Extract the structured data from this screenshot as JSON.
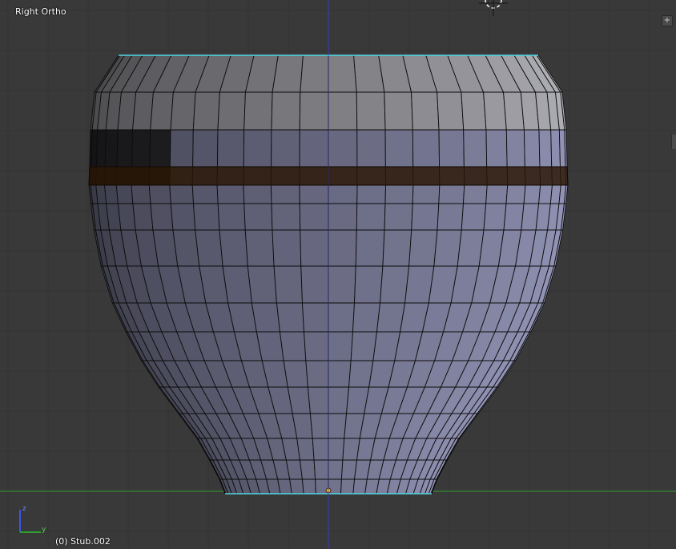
{
  "viewport": {
    "view_label": "Right Ortho",
    "object_label": "(0) Stub.002",
    "background_color": "#393939",
    "grid_color": "#333333"
  },
  "axes": {
    "horizontal_axis_color": "#2ea02e",
    "vertical_axis_color": "#3b3bb4",
    "gizmo_labels": {
      "z": "z",
      "y": "y"
    }
  },
  "mesh": {
    "object_type": "pot-shaped mesh (edit mode)",
    "selected_loop_color": "#3a2208",
    "boundary_edge_color": "#4fd9e6",
    "origin_color": "#e8a030"
  },
  "controls": {
    "corner_button_glyph": "+"
  }
}
